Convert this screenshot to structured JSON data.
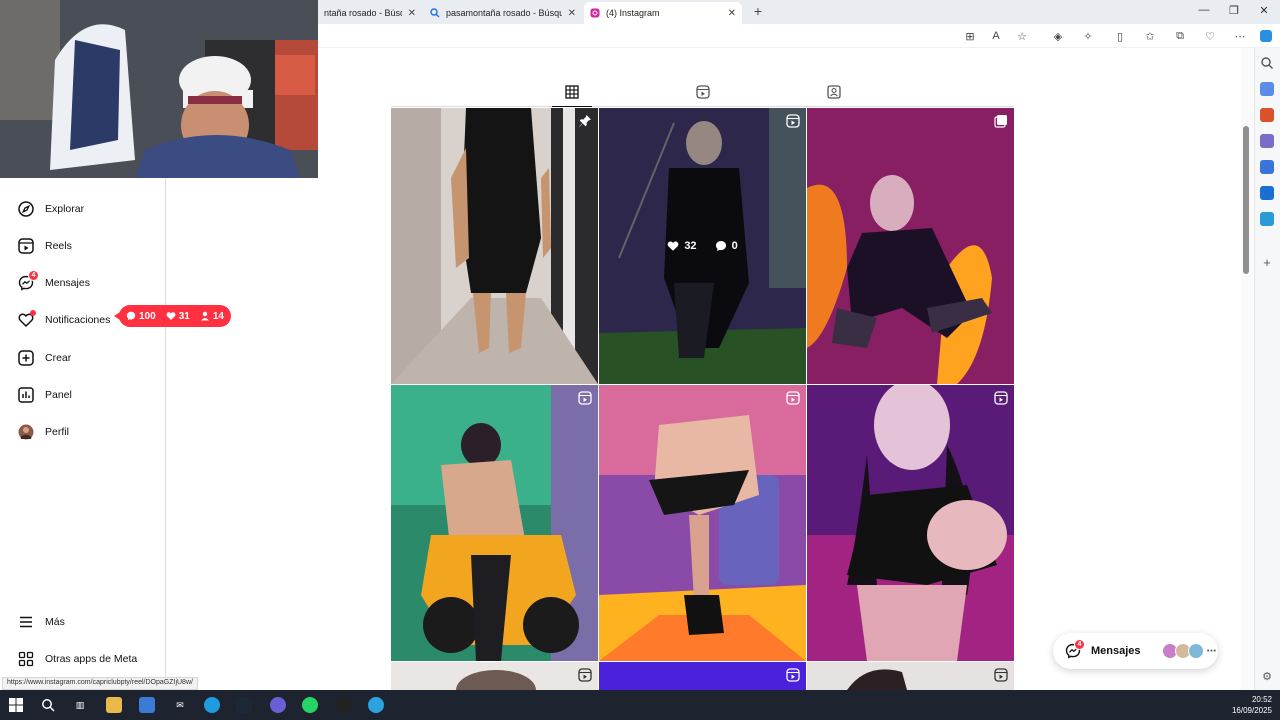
{
  "browser": {
    "tabs": [
      {
        "label": "ntaña rosado - Búsqueda",
        "icon": "search-icon"
      },
      {
        "label": "pasamontaña rosado - Búsqueda",
        "icon": "search-icon"
      },
      {
        "label": "(4) Instagram",
        "icon": "instagram-icon",
        "active": true
      }
    ]
  },
  "nav": {
    "explore": "Explorar",
    "reels": "Reels",
    "messages": "Mensajes",
    "messages_badge": "4",
    "notifications": "Notificaciones",
    "create": "Crear",
    "panel": "Panel",
    "profile": "Perfil",
    "more": "Más",
    "meta_apps": "Otras apps de Meta"
  },
  "notification_popup": {
    "comments": "100",
    "likes": "31",
    "followers": "14"
  },
  "hover_post": {
    "likes": "32",
    "comments": "0"
  },
  "floating_messages": {
    "label": "Mensajes",
    "badge": "4"
  },
  "status_url": "https://www.instagram.com/capriclubpty/reel/DOpaGZIjU8w/",
  "clock": {
    "time": "20:52",
    "date": "16/09/2025"
  },
  "colors": {
    "notification_red": "#ff3040",
    "taskbar": "#1d2430"
  }
}
